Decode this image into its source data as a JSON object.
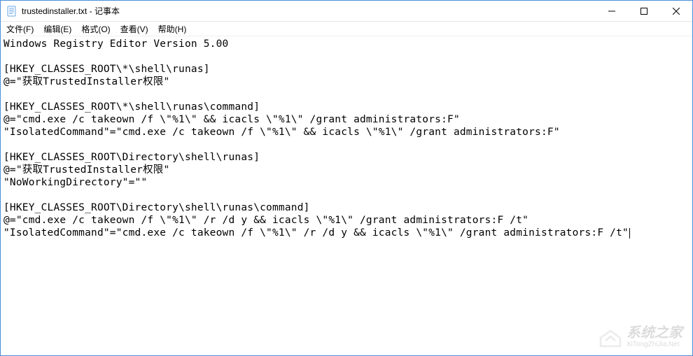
{
  "window": {
    "title": "trustedinstaller.txt - 记事本",
    "app_icon": "notepad-icon"
  },
  "controls": {
    "minimize": "—",
    "maximize": "☐",
    "close": "✕"
  },
  "menu": {
    "file": "文件(F)",
    "edit": "编辑(E)",
    "format": "格式(O)",
    "view": "查看(V)",
    "help": "帮助(H)"
  },
  "document": {
    "lines": [
      "Windows Registry Editor Version 5.00",
      "",
      "[HKEY_CLASSES_ROOT\\*\\shell\\runas]",
      "@=\"获取TrustedInstaller权限\"",
      "",
      "[HKEY_CLASSES_ROOT\\*\\shell\\runas\\command]",
      "@=\"cmd.exe /c takeown /f \\\"%1\\\" && icacls \\\"%1\\\" /grant administrators:F\"",
      "\"IsolatedCommand\"=\"cmd.exe /c takeown /f \\\"%1\\\" && icacls \\\"%1\\\" /grant administrators:F\"",
      "",
      "[HKEY_CLASSES_ROOT\\Directory\\shell\\runas]",
      "@=\"获取TrustedInstaller权限\"",
      "\"NoWorkingDirectory\"=\"\"",
      "",
      "[HKEY_CLASSES_ROOT\\Directory\\shell\\runas\\command]",
      "@=\"cmd.exe /c takeown /f \\\"%1\\\" /r /d y && icacls \\\"%1\\\" /grant administrators:F /t\"",
      "\"IsolatedCommand\"=\"cmd.exe /c takeown /f \\\"%1\\\" /r /d y && icacls \\\"%1\\\" /grant administrators:F /t\""
    ]
  },
  "watermark": {
    "text": "系统之家",
    "sub": "XiTongZhiJia.Net"
  }
}
